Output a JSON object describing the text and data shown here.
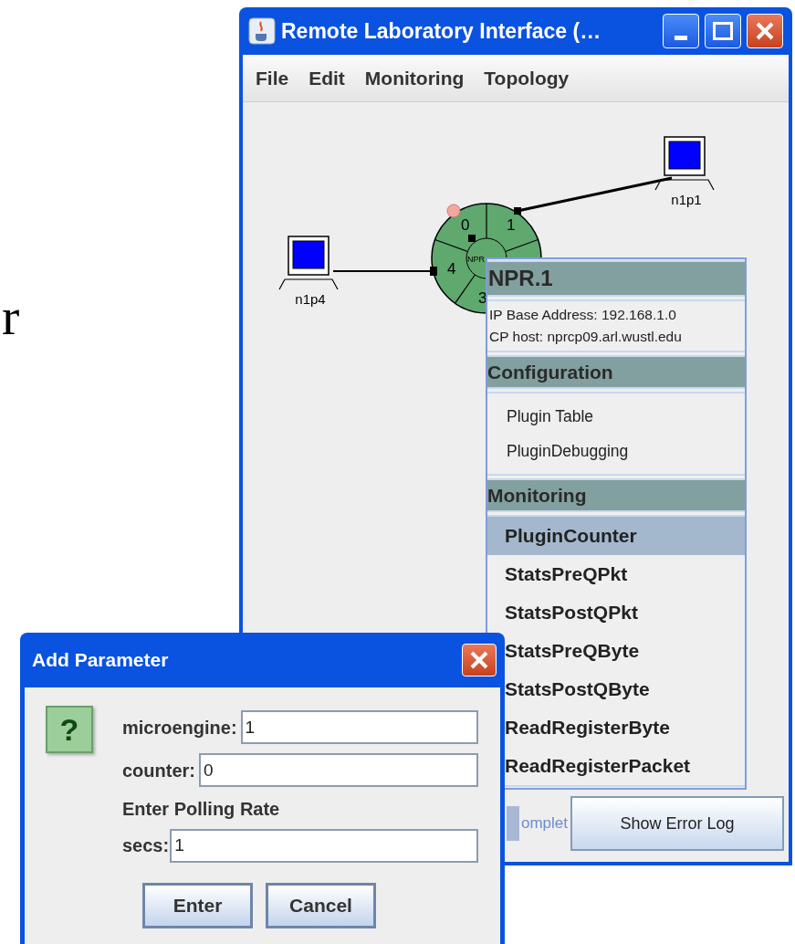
{
  "background_text": "r",
  "main_window": {
    "title": "Remote Laboratory Interface (…",
    "menu": [
      "File",
      "Edit",
      "Monitoring",
      "Topology"
    ],
    "topology": {
      "hosts": [
        {
          "label": "n1p1"
        },
        {
          "label": "n1p4"
        }
      ],
      "router": {
        "label": "NPR",
        "ports": [
          "0",
          "1",
          "4",
          "3"
        ]
      }
    },
    "popup": {
      "title": "NPR.1",
      "info": [
        "IP Base Address: 192.168.1.0",
        "CP host: nprcp09.arl.wustl.edu"
      ],
      "sections": [
        {
          "title": "Configuration",
          "bold": false,
          "items": [
            {
              "label": "Plugin Table",
              "selected": false
            },
            {
              "label": "PluginDebugging",
              "selected": false
            }
          ]
        },
        {
          "title": "Monitoring",
          "bold": true,
          "items": [
            {
              "label": "PluginCounter",
              "selected": true
            },
            {
              "label": "StatsPreQPkt",
              "selected": false
            },
            {
              "label": "StatsPostQPkt",
              "selected": false
            },
            {
              "label": "StatsPreQByte",
              "selected": false
            },
            {
              "label": "StatsPostQByte",
              "selected": false
            },
            {
              "label": "ReadRegisterByte",
              "selected": false
            },
            {
              "label": "ReadRegisterPacket",
              "selected": false
            }
          ]
        }
      ]
    },
    "status_text": "omplet",
    "error_log_button": "Show Error Log"
  },
  "dialog": {
    "title": "Add Parameter",
    "icon_text": "?",
    "fields": [
      {
        "label": "microengine:",
        "value": "1"
      },
      {
        "label": "counter:",
        "value": "0"
      }
    ],
    "polling_label": "Enter Polling Rate",
    "secs_field": {
      "label": "secs:",
      "value": "1"
    },
    "buttons": [
      "Enter",
      "Cancel"
    ]
  }
}
